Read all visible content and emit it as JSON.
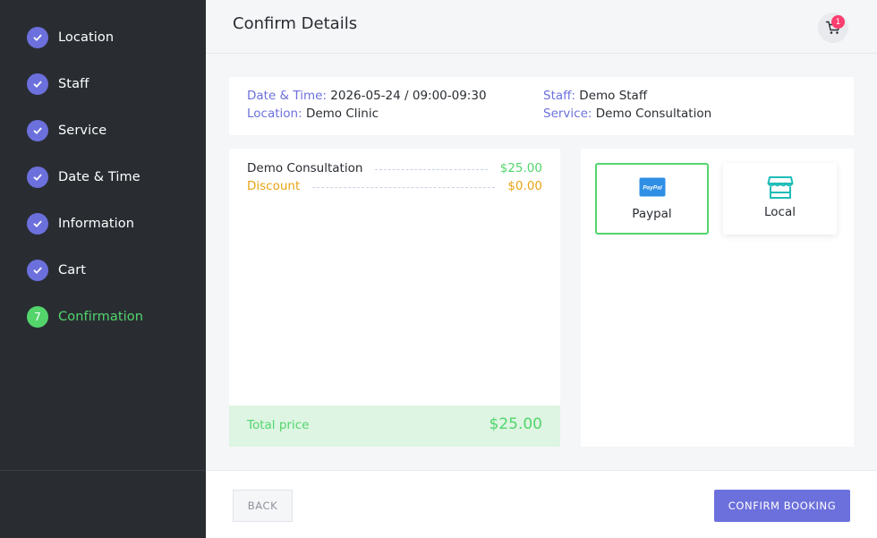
{
  "sidebar": {
    "steps": [
      {
        "label": "Location",
        "state": "done"
      },
      {
        "label": "Staff",
        "state": "done"
      },
      {
        "label": "Service",
        "state": "done"
      },
      {
        "label": "Date & Time",
        "state": "done"
      },
      {
        "label": "Information",
        "state": "done"
      },
      {
        "label": "Cart",
        "state": "done"
      },
      {
        "label": "Confirmation",
        "state": "active",
        "number": "7"
      }
    ]
  },
  "header": {
    "title": "Confirm Details",
    "cart_count": "1"
  },
  "details": {
    "date_time_key": "Date & Time:",
    "date_time_value": "2026-05-24 / 09:00-09:30",
    "location_key": "Location:",
    "location_value": "Demo Clinic",
    "staff_key": "Staff:",
    "staff_value": "Demo Staff",
    "service_key": "Service:",
    "service_value": "Demo Consultation"
  },
  "summary": {
    "items": [
      {
        "name": "Demo Consultation",
        "price": "$25.00"
      },
      {
        "name": "Discount",
        "price": "$0.00"
      }
    ],
    "total_label": "Total price",
    "total_value": "$25.00"
  },
  "payments": {
    "options": [
      {
        "label": "Paypal",
        "icon": "paypal-icon",
        "selected": true
      },
      {
        "label": "Local",
        "icon": "store-icon",
        "selected": false
      }
    ]
  },
  "footer": {
    "back_label": "BACK",
    "confirm_label": "CONFIRM BOOKING"
  },
  "colors": {
    "accent": "#6c70dc",
    "success": "#53d56c",
    "discount": "#e8a317",
    "sidebar_bg": "#292d32",
    "badge": "#fb3e6e"
  }
}
